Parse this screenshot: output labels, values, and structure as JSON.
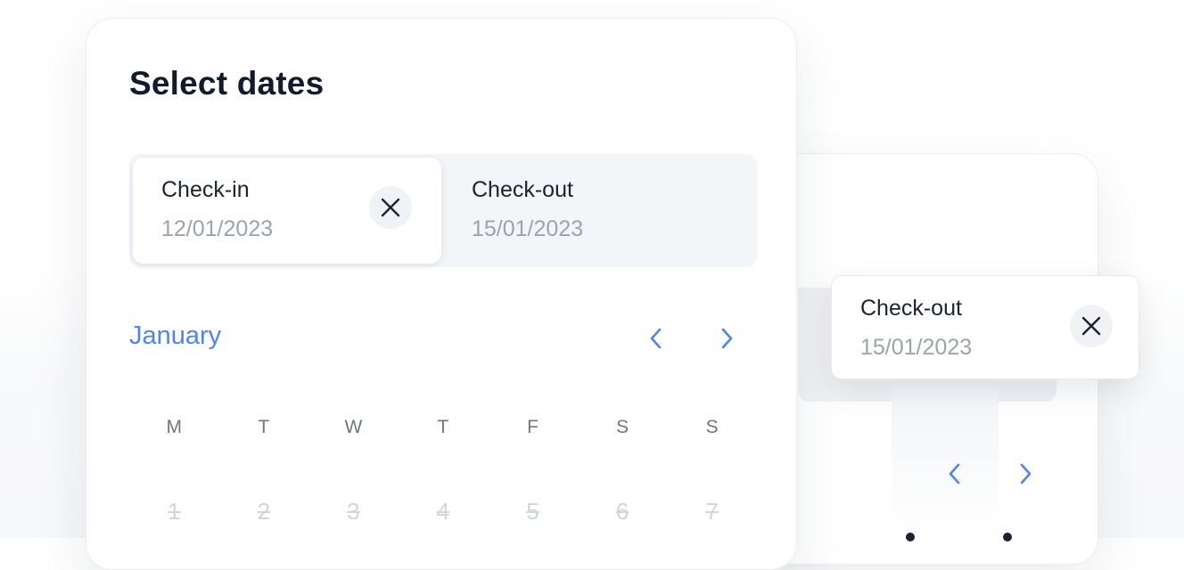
{
  "title": "Select dates",
  "checkin": {
    "label": "Check-in",
    "date": "12/01/2023"
  },
  "checkout": {
    "label": "Check-out",
    "date": "15/01/2023"
  },
  "floating_checkout": {
    "label": "Check-out",
    "date": "15/01/2023"
  },
  "calendar": {
    "month": "January",
    "weekdays": [
      "M",
      "T",
      "W",
      "T",
      "F",
      "S",
      "S"
    ],
    "days": [
      "1",
      "2",
      "3",
      "4",
      "5",
      "6",
      "7"
    ]
  },
  "icons": {
    "clear": "close-icon",
    "prev": "chevron-left-icon",
    "next": "chevron-right-icon"
  },
  "colors": {
    "accent": "#4f86ec",
    "title": "#121a2b",
    "muted": "#9da3ad",
    "disabled_day": "#d2d5db",
    "range_bg": "#f4f5f8"
  }
}
